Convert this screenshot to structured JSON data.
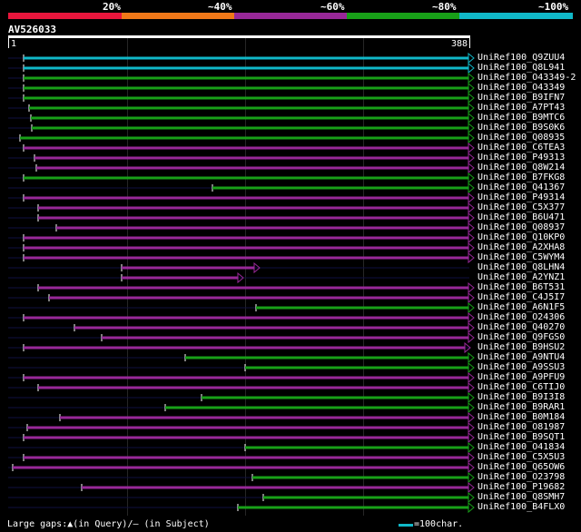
{
  "legend": {
    "labels": [
      "20%",
      "~40%",
      "~60%",
      "~80%",
      "~100%"
    ],
    "colors": [
      "#e8163c",
      "#f07818",
      "#982898",
      "#18a018",
      "#10b8c8"
    ]
  },
  "query": {
    "name": "AV526033",
    "start": "1",
    "end": "388"
  },
  "hits": [
    {
      "name": "UniRef100_Q9ZUU4",
      "color": "cyan"
    },
    {
      "name": "UniRef100_Q8L941",
      "color": "cyan"
    },
    {
      "name": "UniRef100_O43349-2",
      "color": "green"
    },
    {
      "name": "UniRef100_O43349",
      "color": "green"
    },
    {
      "name": "UniRef100_B9IFN7",
      "color": "green"
    },
    {
      "name": "UniRef100_A7PT43",
      "color": "green"
    },
    {
      "name": "UniRef100_B9MTC6",
      "color": "green"
    },
    {
      "name": "UniRef100_B9S0K6",
      "color": "green"
    },
    {
      "name": "UniRef100_Q08935",
      "color": "green"
    },
    {
      "name": "UniRef100_C6TEA3",
      "color": "purple"
    },
    {
      "name": "UniRef100_P49313",
      "color": "purple"
    },
    {
      "name": "UniRef100_Q8W214",
      "color": "purple"
    },
    {
      "name": "UniRef100_B7FKG8",
      "color": "green"
    },
    {
      "name": "UniRef100_Q41367",
      "color": "green"
    },
    {
      "name": "UniRef100_P49314",
      "color": "purple"
    },
    {
      "name": "UniRef100_C5X377",
      "color": "purple"
    },
    {
      "name": "UniRef100_B6U471",
      "color": "purple"
    },
    {
      "name": "UniRef100_Q08937",
      "color": "purple"
    },
    {
      "name": "UniRef100_Q10KP0",
      "color": "purple"
    },
    {
      "name": "UniRef100_A2XHA8",
      "color": "purple"
    },
    {
      "name": "UniRef100_C5WYM4",
      "color": "purple"
    },
    {
      "name": "UniRef100_Q8LHN4",
      "color": "purple"
    },
    {
      "name": "UniRef100_A2YNZ1",
      "color": "purple"
    },
    {
      "name": "UniRef100_B6T531",
      "color": "purple"
    },
    {
      "name": "UniRef100_C4J5I7",
      "color": "purple"
    },
    {
      "name": "UniRef100_A6N1F5",
      "color": "green"
    },
    {
      "name": "UniRef100_O24306",
      "color": "purple"
    },
    {
      "name": "UniRef100_Q40270",
      "color": "purple"
    },
    {
      "name": "UniRef100_Q9FGS0",
      "color": "purple"
    },
    {
      "name": "UniRef100_B9HSU2",
      "color": "purple"
    },
    {
      "name": "UniRef100_A9NTU4",
      "color": "green"
    },
    {
      "name": "UniRef100_A9SSU3",
      "color": "green"
    },
    {
      "name": "UniRef100_A9PFU9",
      "color": "purple"
    },
    {
      "name": "UniRef100_C6TIJ0",
      "color": "purple"
    },
    {
      "name": "UniRef100_B9I3I8",
      "color": "green"
    },
    {
      "name": "UniRef100_B9RAR1",
      "color": "green"
    },
    {
      "name": "UniRef100_B0M184",
      "color": "purple"
    },
    {
      "name": "UniRef100_O81987",
      "color": "purple"
    },
    {
      "name": "UniRef100_B9SQT1",
      "color": "purple"
    },
    {
      "name": "UniRef100_O41834",
      "color": "green"
    },
    {
      "name": "UniRef100_C5X5U3",
      "color": "purple"
    },
    {
      "name": "UniRef100_Q65OW6",
      "color": "purple"
    },
    {
      "name": "UniRef100_O23798",
      "color": "green"
    },
    {
      "name": "UniRef100_P19682",
      "color": "purple"
    },
    {
      "name": "UniRef100_Q8SMH7",
      "color": "green"
    },
    {
      "name": "UniRef100_B4FLX0",
      "color": "green"
    }
  ],
  "footer": {
    "note": "Large gaps:▲(in Query)/– (in Subject)",
    "scale": "=100char."
  }
}
